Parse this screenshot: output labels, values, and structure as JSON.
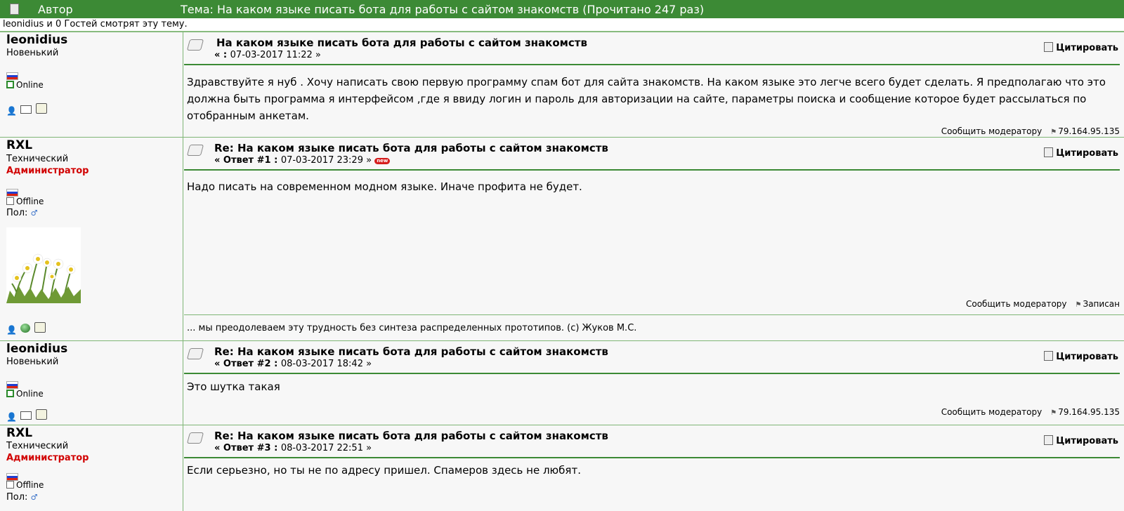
{
  "header": {
    "author_label": "Автор",
    "topic_title": "Тема: На каком языке писать бота для работы с сайтом знакомств  (Прочитано 247 раз)"
  },
  "viewers_text": "leonidius и 0 Гостей смотрят эту тему.",
  "posts": [
    {
      "username": "leonidius",
      "rank": "Новенький",
      "rank2": "",
      "status": "Online",
      "subject": "На каком языке писать бота для работы с сайтом знакомств",
      "meta_prefix": "« : ",
      "meta_date": "07-03-2017 11:22 »",
      "quote_label": "Цитировать",
      "body": "Здравствуйте я нуб . Хочу написать свою первую программу спам бот для сайта знакомств. На каком языке это легче всего будет сделать. Я предполагаю что это должна быть программа я интерфейсом ,где я ввиду логин и пароль для авторизации на сайте, параметры поиска и сообщение которое будет рассылаться по отобранным анкетам.",
      "report_label": "Сообщить модератору",
      "ip": "79.164.95.135"
    },
    {
      "username": "RXL",
      "rank": "Технический",
      "rank2": "Администратор",
      "status": "Offline",
      "gender_label": "Пол:",
      "gender_icon": "♂",
      "subject": "Re: На каком языке писать бота для работы с сайтом знакомств",
      "meta_prefix": "« Ответ #1 : ",
      "meta_date": "07-03-2017 23:29 »",
      "badge": "new",
      "quote_label": "Цитировать",
      "body": "Надо писать на современном модном языке. Иначе профита не будет.",
      "report_label": "Сообщить модератору",
      "ip": "Записан",
      "signature": "... мы преодолеваем эту трудность без синтеза распределенных прототипов. (c) Жуков М.С."
    },
    {
      "username": "leonidius",
      "rank": "Новенький",
      "rank2": "",
      "status": "Online",
      "subject": "Re: На каком языке писать бота для работы с сайтом знакомств",
      "meta_prefix": "« Ответ #2 : ",
      "meta_date": "08-03-2017 18:42 »",
      "quote_label": "Цитировать",
      "body": "Это шутка такая",
      "report_label": "Сообщить модератору",
      "ip": "79.164.95.135"
    },
    {
      "username": "RXL",
      "rank": "Технический",
      "rank2": "Администратор",
      "status": "Offline",
      "gender_label": "Пол:",
      "gender_icon": "♂",
      "subject": "Re: На каком языке писать бота для работы с сайтом знакомств",
      "meta_prefix": "« Ответ #3 : ",
      "meta_date": "08-03-2017 22:51 »",
      "quote_label": "Цитировать",
      "body": "Если серьезно, но ты не по адресу пришел. Спамеров здесь не любят."
    }
  ],
  "colors": {
    "header_bg": "#3c8a35",
    "admin_rank": "#d10000",
    "border": "#7fb676"
  }
}
